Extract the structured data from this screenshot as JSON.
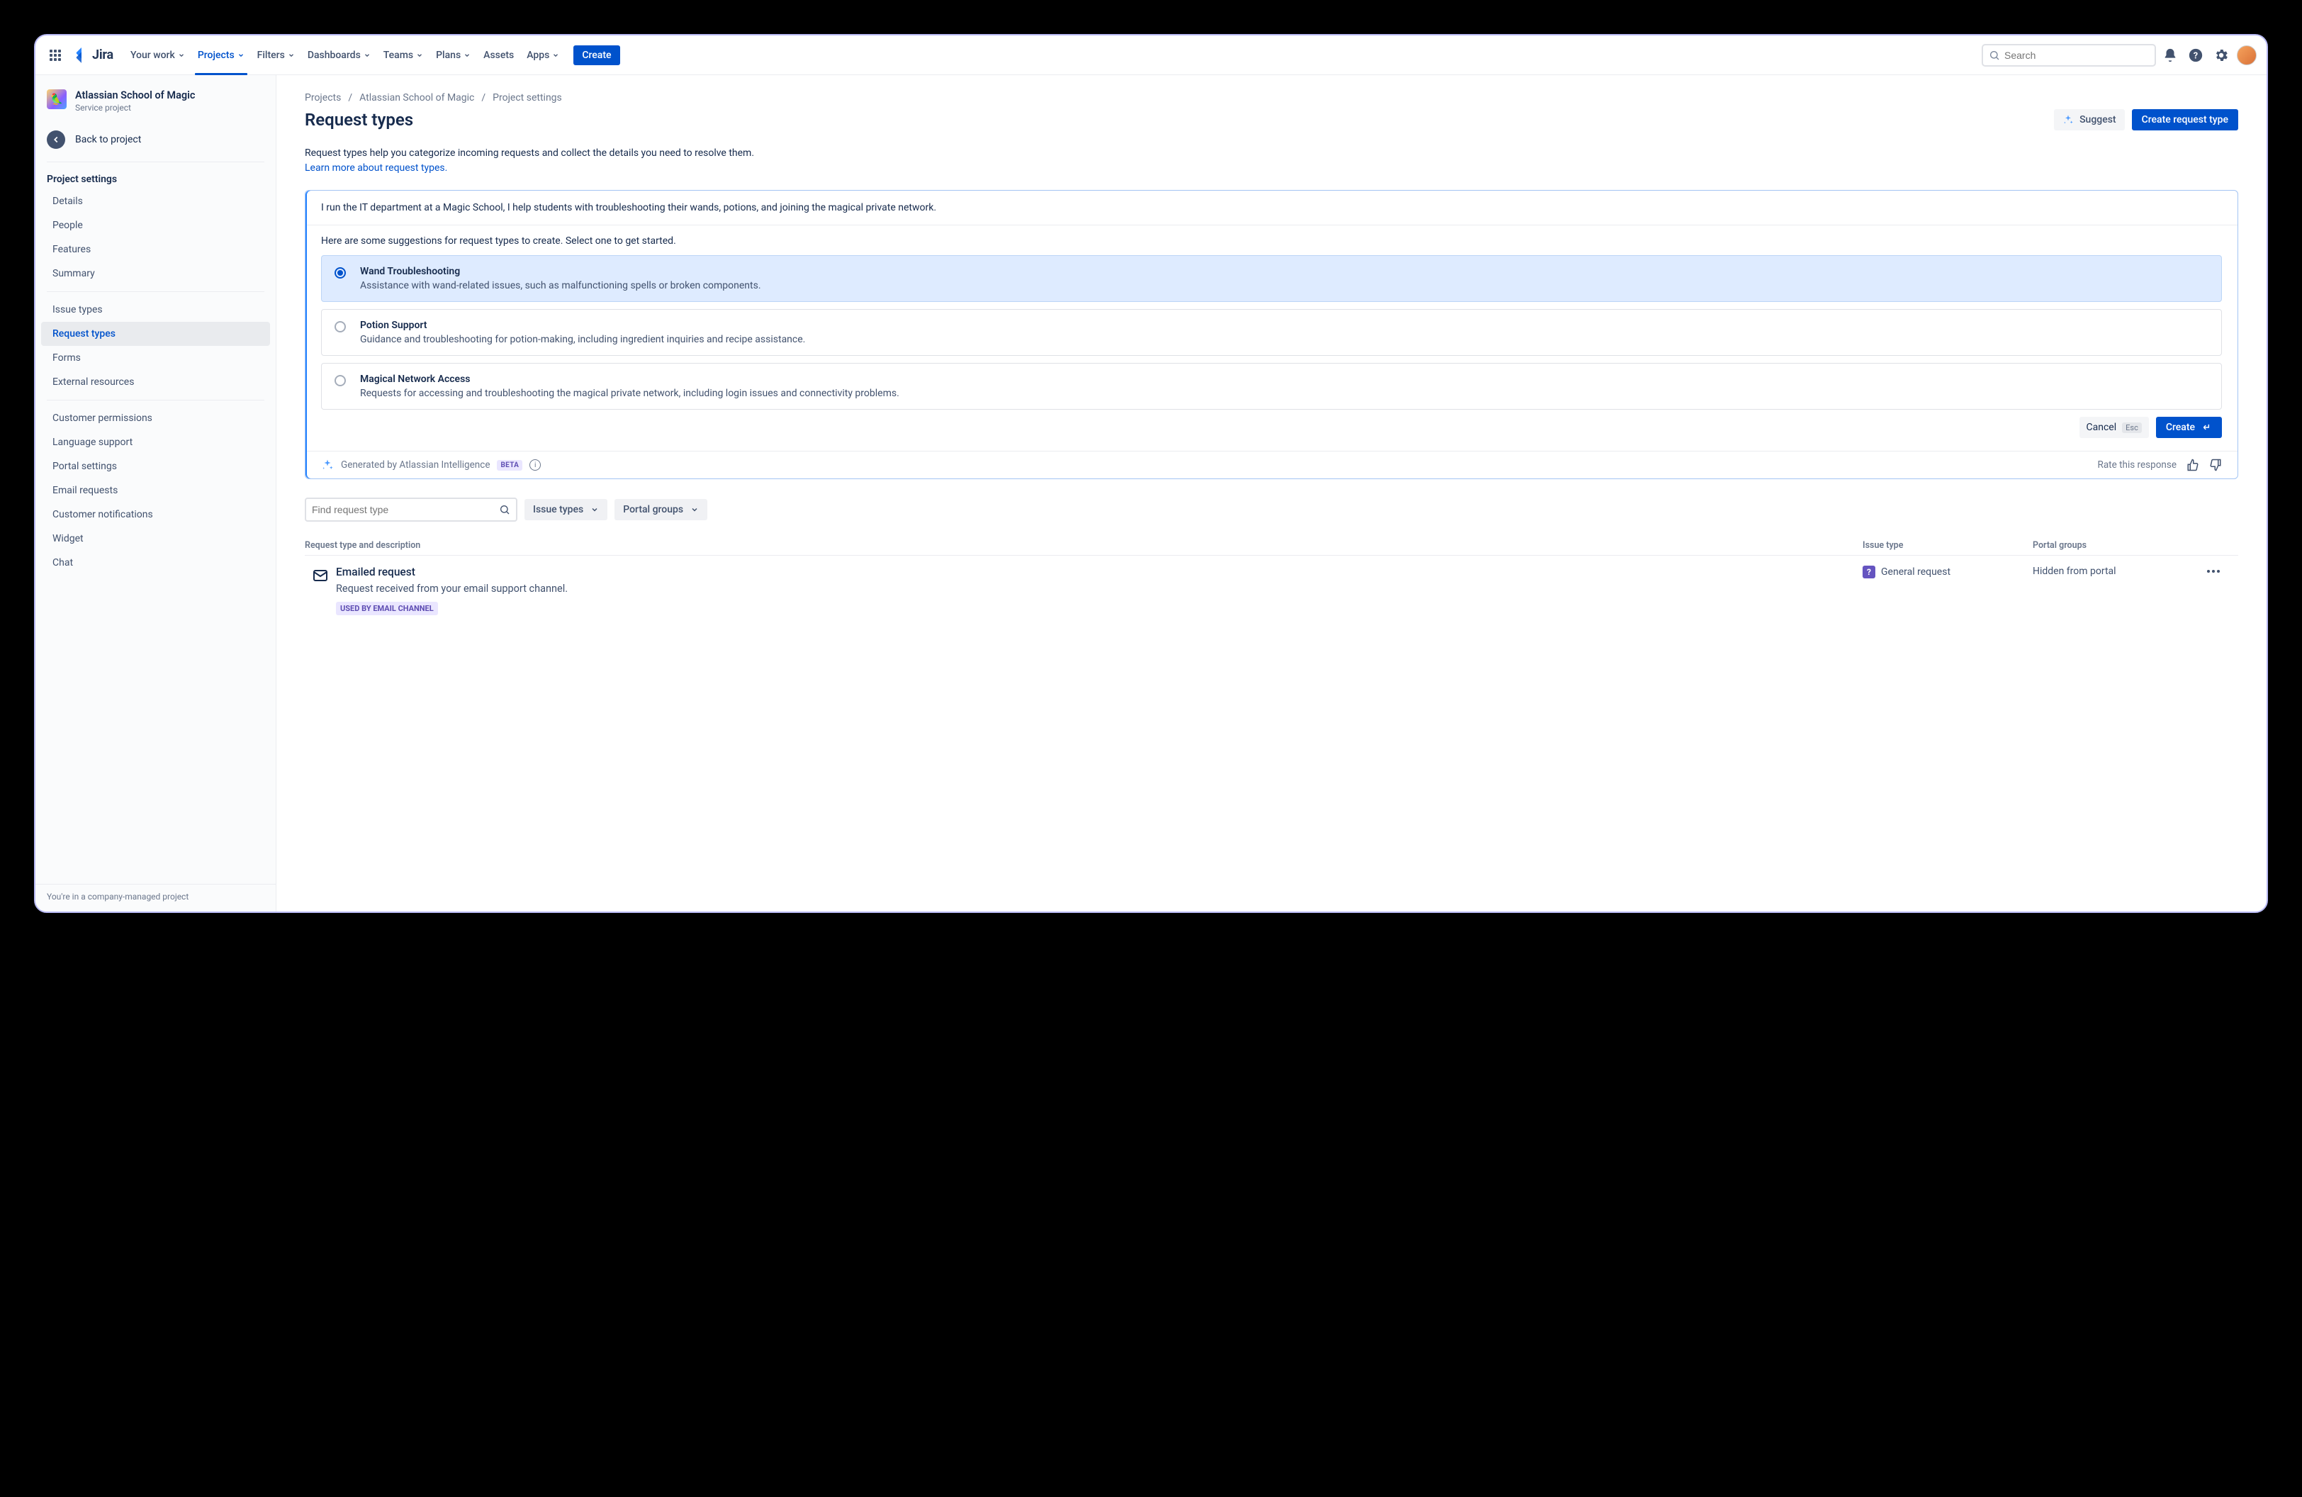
{
  "topnav": {
    "product": "Jira",
    "items": [
      "Your work",
      "Projects",
      "Filters",
      "Dashboards",
      "Teams",
      "Plans",
      "Assets",
      "Apps"
    ],
    "active_index": 1,
    "has_chevron": [
      true,
      true,
      true,
      true,
      true,
      true,
      false,
      true
    ],
    "create": "Create",
    "search_placeholder": "Search"
  },
  "sidebar": {
    "project_name": "Atlassian School of Magic",
    "project_type": "Service project",
    "back": "Back to project",
    "section_title": "Project settings",
    "groups": [
      [
        "Details",
        "People",
        "Features",
        "Summary"
      ],
      [
        "Issue types",
        "Request types",
        "Forms",
        "External resources"
      ],
      [
        "Customer permissions",
        "Language support",
        "Portal settings",
        "Email requests",
        "Customer notifications",
        "Widget",
        "Chat"
      ]
    ],
    "active": "Request types",
    "footer": "You're in a company-managed project"
  },
  "breadcrumbs": [
    "Projects",
    "Atlassian School of Magic",
    "Project settings"
  ],
  "page": {
    "title": "Request types",
    "suggest": "Suggest",
    "create": "Create request type",
    "desc": "Request types help you categorize incoming requests and collect the details you need to resolve them.",
    "learn": "Learn more about request types."
  },
  "ai": {
    "prompt": "I run the IT department at a Magic School, I help students with troubleshooting their wands, potions, and joining the magical private network.",
    "intro": "Here are some suggestions for request types to create. Select one to get started.",
    "suggestions": [
      {
        "title": "Wand Troubleshooting",
        "desc": "Assistance with wand-related issues, such as malfunctioning spells or broken components.",
        "selected": true
      },
      {
        "title": "Potion Support",
        "desc": "Guidance and troubleshooting for potion-making, including ingredient inquiries and recipe assistance.",
        "selected": false
      },
      {
        "title": "Magical Network Access",
        "desc": "Requests for accessing and troubleshooting the magical private network, including login issues and connectivity problems.",
        "selected": false
      }
    ],
    "cancel": "Cancel",
    "esc": "Esc",
    "create": "Create",
    "generated_by": "Generated by Atlassian Intelligence",
    "beta": "BETA",
    "rate": "Rate this response"
  },
  "filters": {
    "find_placeholder": "Find request type",
    "issue_types": "Issue types",
    "portal_groups": "Portal groups"
  },
  "table": {
    "headers": {
      "a": "Request type and description",
      "b": "Issue type",
      "c": "Portal groups"
    },
    "row": {
      "title": "Emailed request",
      "desc": "Request received from your email support channel.",
      "chip": "USED BY EMAIL CHANNEL",
      "issue_type": "General request",
      "portal": "Hidden from portal"
    }
  }
}
